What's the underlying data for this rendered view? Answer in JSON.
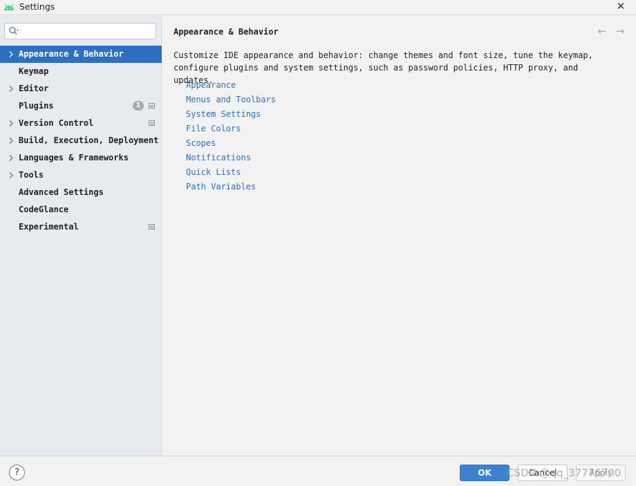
{
  "window": {
    "title": "Settings",
    "close_glyph": "✕",
    "app_icon": "android-icon",
    "accent_color": "#2f6fbf",
    "android_color": "#3ddc84"
  },
  "search": {
    "value": "",
    "placeholder": "",
    "icon": "search-icon"
  },
  "sidebar": {
    "items": [
      {
        "label": "Appearance & Behavior",
        "expandable": true,
        "selected": true
      },
      {
        "label": "Keymap",
        "expandable": false
      },
      {
        "label": "Editor",
        "expandable": true
      },
      {
        "label": "Plugins",
        "expandable": false,
        "badge": "1",
        "project_icon": true
      },
      {
        "label": "Version Control",
        "expandable": true,
        "project_icon": true
      },
      {
        "label": "Build, Execution, Deployment",
        "expandable": true
      },
      {
        "label": "Languages & Frameworks",
        "expandable": true
      },
      {
        "label": "Tools",
        "expandable": true
      },
      {
        "label": "Advanced Settings",
        "expandable": false
      },
      {
        "label": "CodeGlance",
        "expandable": false
      },
      {
        "label": "Experimental",
        "expandable": false,
        "project_icon": true
      }
    ]
  },
  "content": {
    "title": "Appearance & Behavior",
    "back_glyph": "←",
    "forward_glyph": "→",
    "description": "Customize IDE appearance and behavior: change themes and font size, tune the keymap, configure plugins and system settings, such as password policies, HTTP proxy, and updates.",
    "links": [
      "Appearance",
      "Menus and Toolbars",
      "System Settings",
      "File Colors",
      "Scopes",
      "Notifications",
      "Quick Lists",
      "Path Variables"
    ]
  },
  "footer": {
    "help_glyph": "?",
    "ok_label": "OK",
    "cancel_label": "Cancel",
    "apply_label": "Apply",
    "watermark": "CSDN @qq_37776700"
  }
}
